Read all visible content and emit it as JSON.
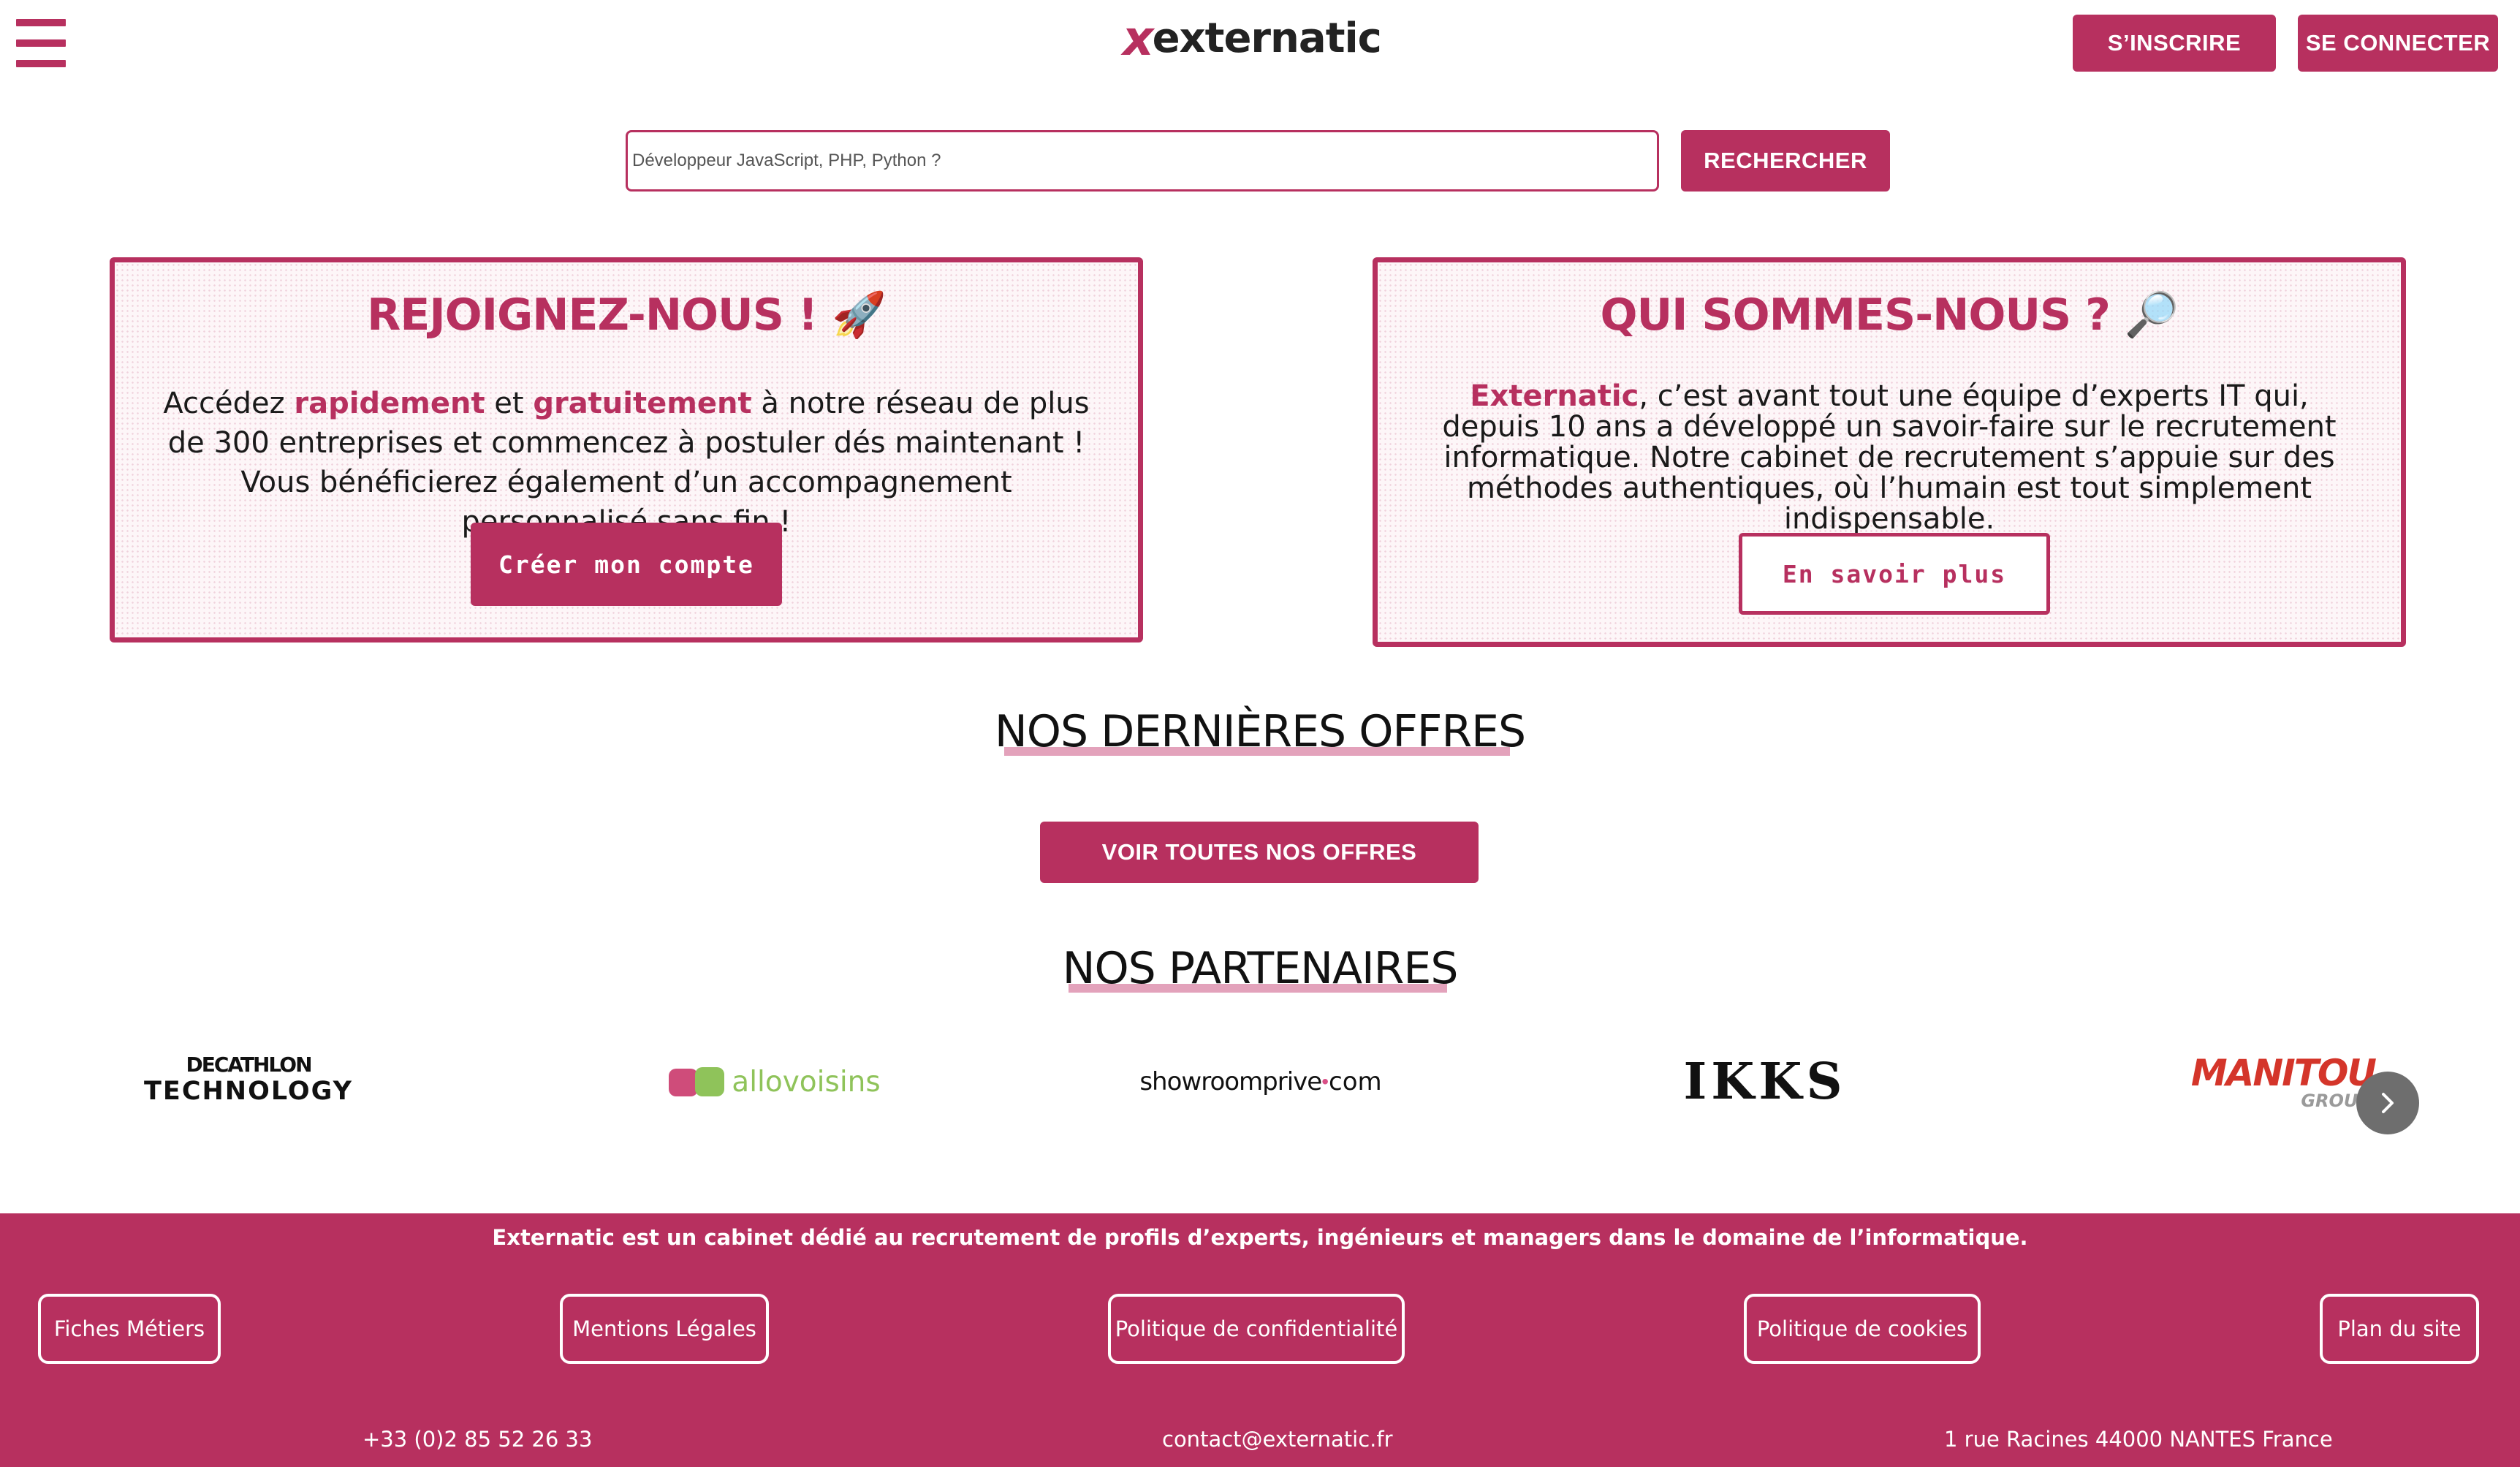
{
  "header": {
    "logo_mark": "x",
    "logo_text": "externatic",
    "signup_label": "S’INSCRIRE",
    "login_label": "SE CONNECTER"
  },
  "search": {
    "placeholder": "Développeur JavaScript, PHP, Python ?",
    "button_label": "RECHERCHER"
  },
  "join_card": {
    "title": "REJOIGNEZ-NOUS ! 🚀",
    "text_1": "Accédez ",
    "highlight_1": "rapidement",
    "text_2": " et ",
    "highlight_2": "gratuitement",
    "text_3": " à notre réseau de plus de 300 entreprises et commencez à postuler dés maintenant ! Vous bénéficierez également d’un accompagnement personnalisé sans fin !",
    "button_label": "Créer mon compte"
  },
  "about_card": {
    "title": "QUI SOMMES-NOUS ? 🔎",
    "highlight": "Externatic",
    "text": ", c’est avant tout une équipe d’experts IT qui, depuis 10 ans a développé un savoir-faire sur le recrutement informatique. Notre cabinet de recrutement s’appuie sur des méthodes authentiques, où l’humain est tout simplement indispensable.",
    "button_label": "En savoir plus"
  },
  "offers": {
    "heading": "NOS DERNIÈRES OFFRES",
    "button_label": "VOIR TOUTES NOS OFFRES"
  },
  "partners": {
    "heading": "NOS PARTENAIRES",
    "logos": [
      {
        "line1": "DECATHLON",
        "line2": "TECHNOLOGY"
      },
      {
        "text": "allovoisins"
      },
      {
        "text": "showroomprive",
        "dot": "•",
        "suffix": "com"
      },
      {
        "text": "IKKS"
      },
      {
        "line1": "MANITOU",
        "line2": "GROUP"
      }
    ],
    "next_icon": "chevron-right-icon"
  },
  "footer": {
    "tagline": "Externatic est un cabinet dédié au recrutement de profils d’experts, ingénieurs et managers dans le domaine de l’informatique.",
    "links": [
      "Fiches Métiers",
      "Mentions Légales",
      "Politique de confidentialité",
      "Politique de cookies",
      "Plan du site"
    ],
    "phone": "+33 (0)2 85 52 26 33",
    "email": "contact@externatic.fr",
    "address": "1 rue Racines 44000 NANTES France"
  },
  "colors": {
    "brand": "#b7305f",
    "underline": "#e3a2bb",
    "carousel_button": "#6e6e6e"
  }
}
